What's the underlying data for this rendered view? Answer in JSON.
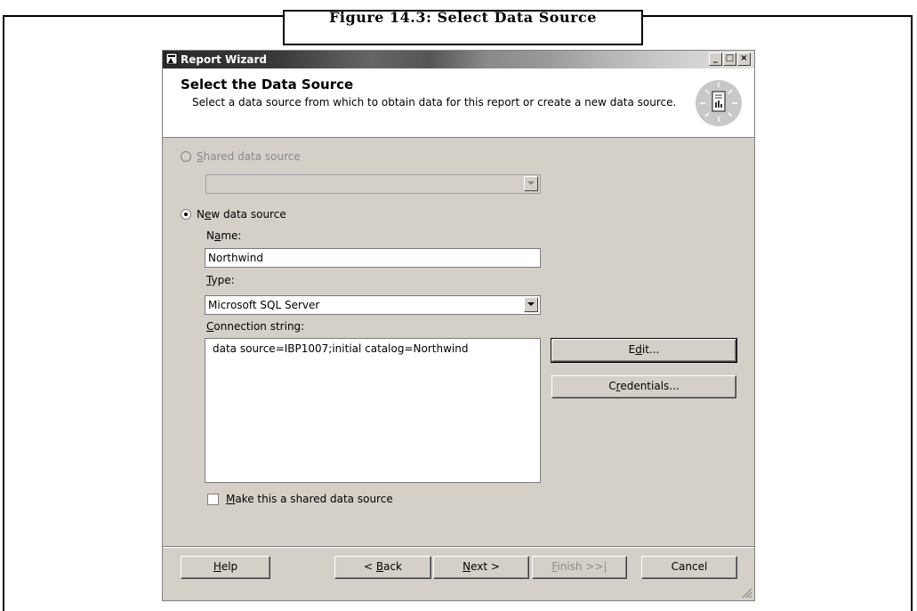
{
  "figure": {
    "caption": "Figure 14.3: Select Data Source"
  },
  "window": {
    "title": "Report Wizard",
    "controls": {
      "minimize": "_",
      "maximize": "□",
      "close": "×"
    }
  },
  "header": {
    "title": "Select the Data Source",
    "description": "Select a data source from which to obtain data for this report or create a new data source.",
    "icon": "report-wizard-icon"
  },
  "shared_source": {
    "label_prefix": "",
    "label_accel": "S",
    "label_rest": "hared data source",
    "selected": false,
    "enabled": false,
    "value": ""
  },
  "new_source": {
    "label_prefix": "N",
    "label_accel": "e",
    "label_rest": "w data source",
    "selected": true
  },
  "name_field": {
    "label_prefix": "N",
    "label_accel": "a",
    "label_rest": "me:",
    "value": "Northwind"
  },
  "type_field": {
    "label_prefix": "",
    "label_accel": "T",
    "label_rest": "ype:",
    "value": "Microsoft SQL Server"
  },
  "connection": {
    "label_prefix": "",
    "label_accel": "C",
    "label_rest": "onnection string:",
    "value": "data source=IBP1007;initial catalog=Northwind"
  },
  "buttons": {
    "edit": {
      "prefix": "E",
      "accel": "d",
      "rest": "it..."
    },
    "credentials": {
      "prefix": "C",
      "accel": "r",
      "rest": "edentials..."
    }
  },
  "make_shared": {
    "label_prefix": "",
    "label_accel": "M",
    "label_rest": "ake this a shared data source",
    "checked": false
  },
  "footer": {
    "help": {
      "prefix": "",
      "accel": "H",
      "rest": "elp"
    },
    "back": {
      "prefix": "< ",
      "accel": "B",
      "rest": "ack"
    },
    "next": {
      "prefix": "",
      "accel": "N",
      "rest": "ext >"
    },
    "finish": {
      "prefix": "",
      "accel": "F",
      "rest": "inish >>|"
    },
    "cancel": {
      "label": "Cancel"
    }
  }
}
